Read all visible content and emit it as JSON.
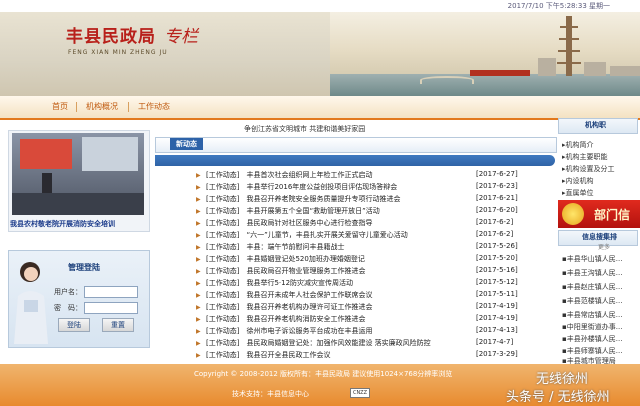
{
  "topbar": {
    "datetime": "2017/7/10 下午5:28:33 星期一"
  },
  "banner": {
    "title": "丰县民政局",
    "script": "专栏",
    "pinyin": "FENG XIAN MIN ZHENG JU"
  },
  "nav": {
    "items": [
      "首页",
      "机构概况",
      "工作动态"
    ]
  },
  "left": {
    "photo_caption": "我县农村敬老院开展消防安全培训",
    "login": {
      "title": "管理登陆",
      "username_label": "用户名：",
      "password_label": "密　码：",
      "login_button": "登陆",
      "reset_button": "重置"
    }
  },
  "center": {
    "slogan": "争创江苏省文明城市 共建和谐美好家园",
    "header_tab": "新动态",
    "news": [
      {
        "title": "[工作动态]　丰县首次社会组织网上年检工作正式启动",
        "date": "[2017-6-27]"
      },
      {
        "title": "[工作动态]　丰县举行2016年度公益创投项目评估现场答辩会",
        "date": "[2017-6-23]"
      },
      {
        "title": "[工作动态]　我县召开养老院安全服务质量提升专项行动推进会",
        "date": "[2017-6-21]"
      },
      {
        "title": "[工作动态]　丰县开展第五个全国“救助管理开放日”活动",
        "date": "[2017-6-20]"
      },
      {
        "title": "[工作动态]　县民政局针对社区服务中心进行检查指导",
        "date": "[2017-6-2]"
      },
      {
        "title": "[工作动态]　“六一”儿童节，丰县扎实开展关爱留守儿童爱心活动",
        "date": "[2017-6-2]"
      },
      {
        "title": "[工作动态]　丰县：端午节前慰问丰县籍战士",
        "date": "[2017-5-26]"
      },
      {
        "title": "[工作动态]　丰县婚姻登记处520加班办理婚姻登记",
        "date": "[2017-5-20]"
      },
      {
        "title": "[工作动态]　县民政局召开物业管理服务工作推进会",
        "date": "[2017-5-16]"
      },
      {
        "title": "[工作动态]　我县举行5·12防灾减灾宣传周活动",
        "date": "[2017-5-12]"
      },
      {
        "title": "[工作动态]　我县召开未成年人社会保护工作联席会议",
        "date": "[2017-5-11]"
      },
      {
        "title": "[工作动态]　我县召开养老机构办理许可证工作推进会",
        "date": "[2017-4-19]"
      },
      {
        "title": "[工作动态]　我县召开养老机构消防安全工作推进会",
        "date": "[2017-4-19]"
      },
      {
        "title": "[工作动态]　徐州市电子诉讼服务平台成功在丰县运用",
        "date": "[2017-4-13]"
      },
      {
        "title": "[工作动态]　县民政局婚姻登记处：加强作风效能建设 落实廉政风险防控",
        "date": "[2017-4-7]"
      },
      {
        "title": "[工作动态]　我县召开全县民政工作会议",
        "date": "[2017-3-29]"
      }
    ]
  },
  "right": {
    "org_title": "机构职",
    "org_items": [
      "机构简介",
      "机构主要职能",
      "机构设置及分工",
      "内设机构",
      "直属单位"
    ],
    "ad_text": "部门信",
    "info_title": "信息搜集排",
    "info_more": "更多",
    "info_items": [
      "丰县华山镇人民...",
      "丰县王沟镇人民...",
      "丰县赵庄镇人民...",
      "丰县范楼镇人民...",
      "丰县常店镇人民...",
      "中阳里街道办事...",
      "丰县孙楼镇人民...",
      "丰县师寨镇人民...",
      "丰县城市管理局"
    ]
  },
  "footer": {
    "copyright": "Copyright © 2008-2012  版权所有：丰县民政局  建议使用1024×768分辨率浏览",
    "tech": "技术支持：丰县信息中心",
    "badge": "CNZZ"
  },
  "watermark": {
    "line1": "无线徐州",
    "line2": "头条号 / 无线徐州"
  }
}
